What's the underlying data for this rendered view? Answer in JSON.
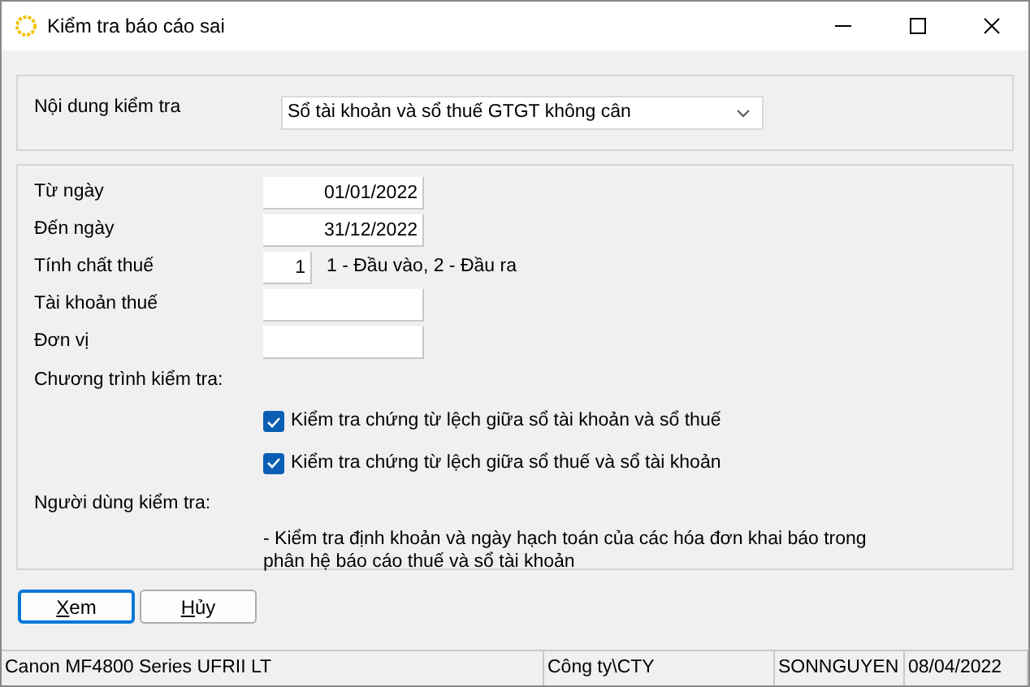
{
  "window": {
    "title": "Kiểm tra báo cáo sai"
  },
  "content_group": {
    "label": "Nội dung kiểm tra",
    "value": "Sổ tài khoản và sổ thuế GTGT không cân"
  },
  "fields": [
    {
      "label": "Từ ngày",
      "value": "01/01/2022",
      "kind": "wide"
    },
    {
      "label": "Đến ngày",
      "value": "31/12/2022",
      "kind": "wide"
    },
    {
      "label": "Tính chất thuế",
      "value": "1",
      "kind": "narrow",
      "hint": "1 - Đầu vào, 2 - Đầu ra"
    },
    {
      "label": "Tài khoản thuế",
      "kind": "wide"
    },
    {
      "label": "Đơn vị",
      "kind": "wide"
    }
  ],
  "program_label": "Chương trình kiểm tra:",
  "checks": [
    {
      "label": "Kiểm tra chứng từ lệch giữa sổ tài khoản và sổ thuế",
      "checked": true
    },
    {
      "label": "Kiểm tra chứng từ lệch giữa sổ thuế và sổ tài khoản",
      "checked": true
    }
  ],
  "user_label": "Người dùng kiểm tra:",
  "description": "- Kiểm tra định khoản và ngày hạch toán của các hóa đơn khai báo trong phân hệ báo cáo thuế và sổ tài khoản",
  "buttons": [
    {
      "label": "Xem",
      "default": true
    },
    {
      "label": "Hủy",
      "default": false
    }
  ],
  "status_bar": [
    "Canon MF4800 Series UFRII LT",
    "Công ty\\CTY",
    "SONNGUYEN",
    "08/04/2022"
  ]
}
